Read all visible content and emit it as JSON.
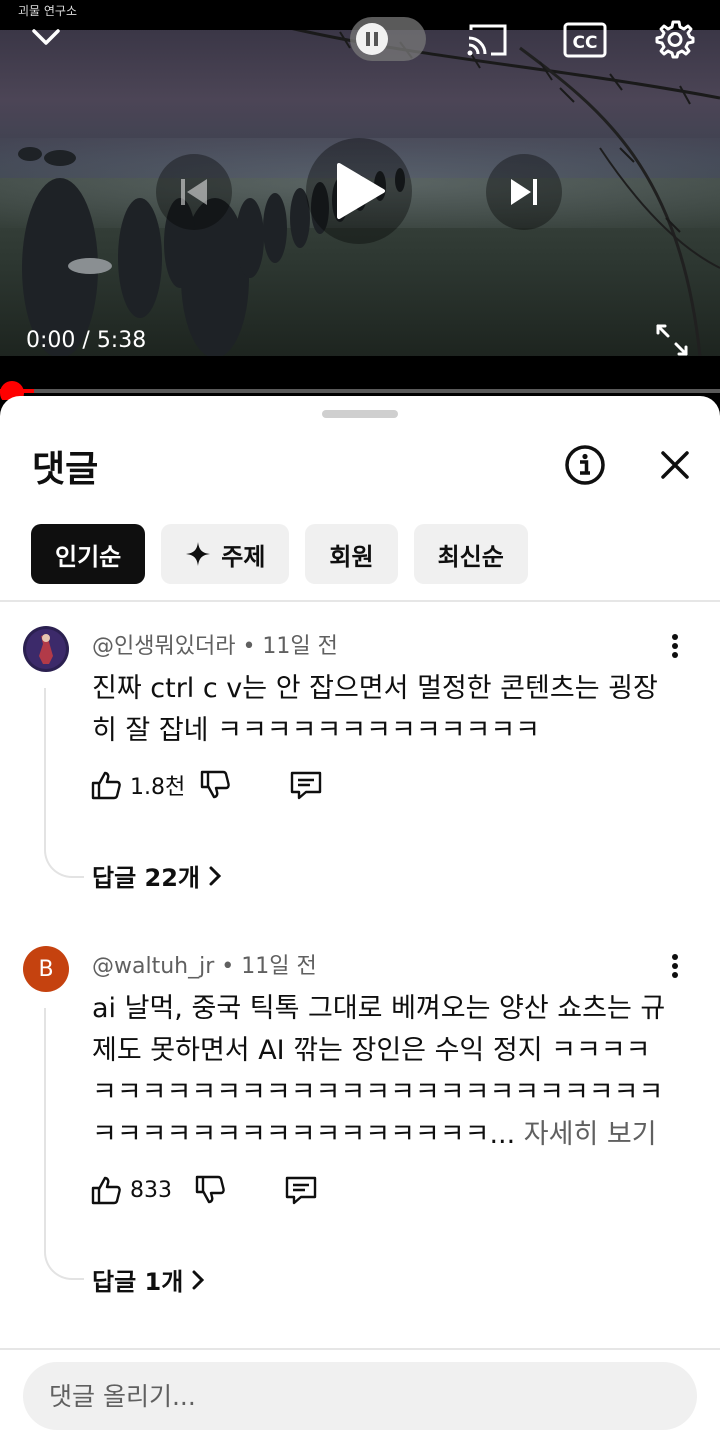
{
  "player": {
    "channel_tag": "괴물 연구소",
    "time_current": "0:00",
    "time_separator": " / ",
    "time_total": "5:38",
    "progress": 0.0,
    "accent": "#ff0000"
  },
  "icons": {
    "collapse": "chevron-down-icon",
    "pause": "pause-icon",
    "cast": "cast-icon",
    "captions": "cc-icon",
    "settings": "gear-icon",
    "previous": "skip-previous-icon",
    "play": "play-icon",
    "next": "skip-next-icon",
    "fullscreen": "fullscreen-icon",
    "info": "info-icon",
    "close": "close-icon",
    "more": "more-vert-icon",
    "like": "thumbs-up-icon",
    "dislike": "thumbs-down-icon",
    "reply": "reply-icon"
  },
  "comments_panel": {
    "title": "댓글",
    "chips": [
      "인기순",
      "주제",
      "회원",
      "최신순"
    ],
    "active_chip": "인기순",
    "comments": [
      {
        "author": "@인생뭐있더라",
        "separator": " • ",
        "time": "11일 전",
        "text": "진짜 ctrl c v는 안 잡으면서 멀정한 콘텐츠는 굉장히 잘 잡네 ㅋㅋㅋㅋㅋㅋㅋㅋㅋㅋㅋㅋㅋ",
        "more": "",
        "likes": "1.8천",
        "replies": "답글 22개"
      },
      {
        "author": "@waltuh_jr",
        "separator": " • ",
        "time": "11일 전",
        "text": "ai 날먹, 중국 틱톡 그대로 베껴오는 양산 쇼츠는 규제도 못하면서 AI 깎는 장인은 수익 정지 ㅋㅋㅋㅋㅋㅋㅋㅋㅋㅋㅋㅋㅋㅋㅋㅋㅋㅋㅋㅋㅋㅋㅋㅋㅋㅋㅋㅋㅋㅋㅋㅋㅋㅋㅋㅋㅋㅋㅋㅋㅋㅋㅋ...",
        "more": " 자세히 보기",
        "avatar_letter": "B",
        "avatar_color": "#c5420f",
        "likes": "833",
        "replies": "답글 1개"
      }
    ],
    "input_placeholder": "댓글 올리기..."
  }
}
